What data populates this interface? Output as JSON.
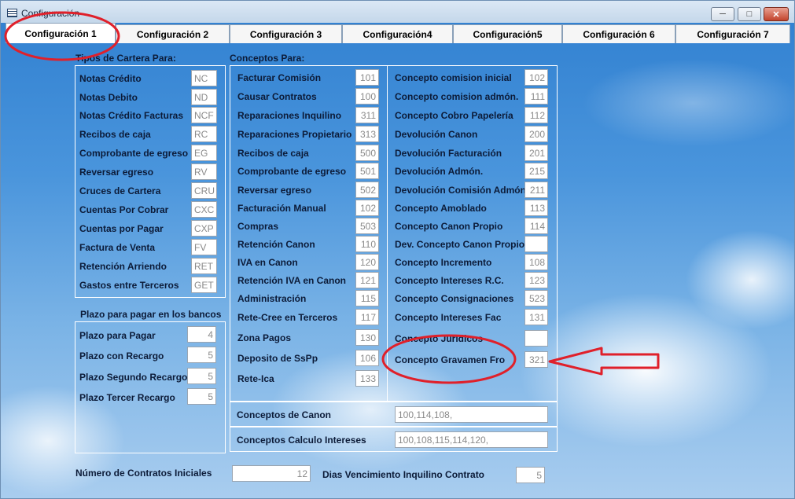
{
  "window": {
    "title": "Configuración"
  },
  "tabs": [
    {
      "label": "Configuración 1"
    },
    {
      "label": "Configuración 2"
    },
    {
      "label": "Configuración 3"
    },
    {
      "label": "Configuración4"
    },
    {
      "label": "Configuración5"
    },
    {
      "label": "Configuración 6"
    },
    {
      "label": "Configuración 7"
    }
  ],
  "cartera": {
    "title": "Tipos de Cartera Para:",
    "items": [
      {
        "label": "Notas Crédito",
        "value": "NC"
      },
      {
        "label": "Notas Debito",
        "value": "ND"
      },
      {
        "label": "Notas Crédito Facturas",
        "value": "NCF"
      },
      {
        "label": "Recibos de caja",
        "value": "RC"
      },
      {
        "label": "Comprobante de egreso",
        "value": "EG"
      },
      {
        "label": "Reversar egreso",
        "value": "RV"
      },
      {
        "label": "Cruces de Cartera",
        "value": "CRU"
      },
      {
        "label": "Cuentas Por Cobrar",
        "value": "CXC"
      },
      {
        "label": "Cuentas por Pagar",
        "value": "CXP"
      },
      {
        "label": "Factura de Venta",
        "value": "FV"
      },
      {
        "label": "Retención Arriendo",
        "value": "RET"
      },
      {
        "label": "Gastos entre Terceros",
        "value": "GET"
      }
    ]
  },
  "plazo": {
    "title": "Plazo para pagar en los bancos",
    "items": [
      {
        "label": "Plazo para Pagar",
        "value": "4"
      },
      {
        "label": "Plazo con Recargo",
        "value": "5"
      },
      {
        "label": "Plazo Segundo Recargo",
        "value": "5"
      },
      {
        "label": "Plazo Tercer Recargo",
        "value": "5"
      }
    ]
  },
  "conceptos": {
    "title": "Conceptos Para:",
    "col1": [
      {
        "label": "Facturar Comisión",
        "value": "101"
      },
      {
        "label": "Causar Contratos",
        "value": "100"
      },
      {
        "label": "Reparaciones Inquilino",
        "value": "311"
      },
      {
        "label": "Reparaciones Propietario",
        "value": "313"
      },
      {
        "label": "Recibos de caja",
        "value": "500"
      },
      {
        "label": "Comprobante de egreso",
        "value": "501"
      },
      {
        "label": "Reversar egreso",
        "value": "502"
      },
      {
        "label": "Facturación Manual",
        "value": "102"
      },
      {
        "label": "Compras",
        "value": "503"
      },
      {
        "label": "Retención Canon",
        "value": "110"
      },
      {
        "label": "IVA en Canon",
        "value": "120"
      },
      {
        "label": "Retención IVA en Canon",
        "value": "121"
      },
      {
        "label": "Administración",
        "value": "115"
      },
      {
        "label": "Rete-Cree en Terceros",
        "value": "117"
      },
      {
        "label": "Zona Pagos",
        "value": "130"
      },
      {
        "label": "Deposito de SsPp",
        "value": "106"
      },
      {
        "label": "Rete-Ica",
        "value": "133"
      }
    ],
    "col2": [
      {
        "label": "Concepto comision inicial",
        "value": "102"
      },
      {
        "label": "Concepto comision admón.",
        "value": "111"
      },
      {
        "label": "Concepto Cobro Papelería",
        "value": "112"
      },
      {
        "label": "Devolución Canon",
        "value": "200"
      },
      {
        "label": "Devolución Facturación",
        "value": "201"
      },
      {
        "label": "Devolución Admón.",
        "value": "215"
      },
      {
        "label": "Devolución Comisión Admón.",
        "value": "211"
      },
      {
        "label": "Concepto Amoblado",
        "value": "113"
      },
      {
        "label": "Concepto Canon Propio",
        "value": "114"
      },
      {
        "label": "Dev. Concepto Canon Propio",
        "value": ""
      },
      {
        "label": "Concepto Incremento",
        "value": "108"
      },
      {
        "label": "Concepto Intereses R.C.",
        "value": "123"
      },
      {
        "label": "Concepto Consignaciones",
        "value": "523"
      },
      {
        "label": "Concepto Intereses Fac",
        "value": "131"
      },
      {
        "label": "Concepto Juridicos",
        "value": ""
      },
      {
        "label": "Concepto Gravamen Fro",
        "value": "321"
      }
    ]
  },
  "lists": {
    "canon_label": "Conceptos de Canon",
    "canon_value": "100,114,108,",
    "intereses_label": "Conceptos Calculo Intereses",
    "intereses_value": "100,108,115,114,120,"
  },
  "footer": {
    "contratos_label": "Número de Contratos Iniciales",
    "contratos_value": "12",
    "dias_label": "Dias Vencimiento Inquilino Contrato",
    "dias_value": "5"
  },
  "colors": {
    "annotation": "#e0202a",
    "panel_border": "#ffffff",
    "sky": "#4a95dc"
  }
}
